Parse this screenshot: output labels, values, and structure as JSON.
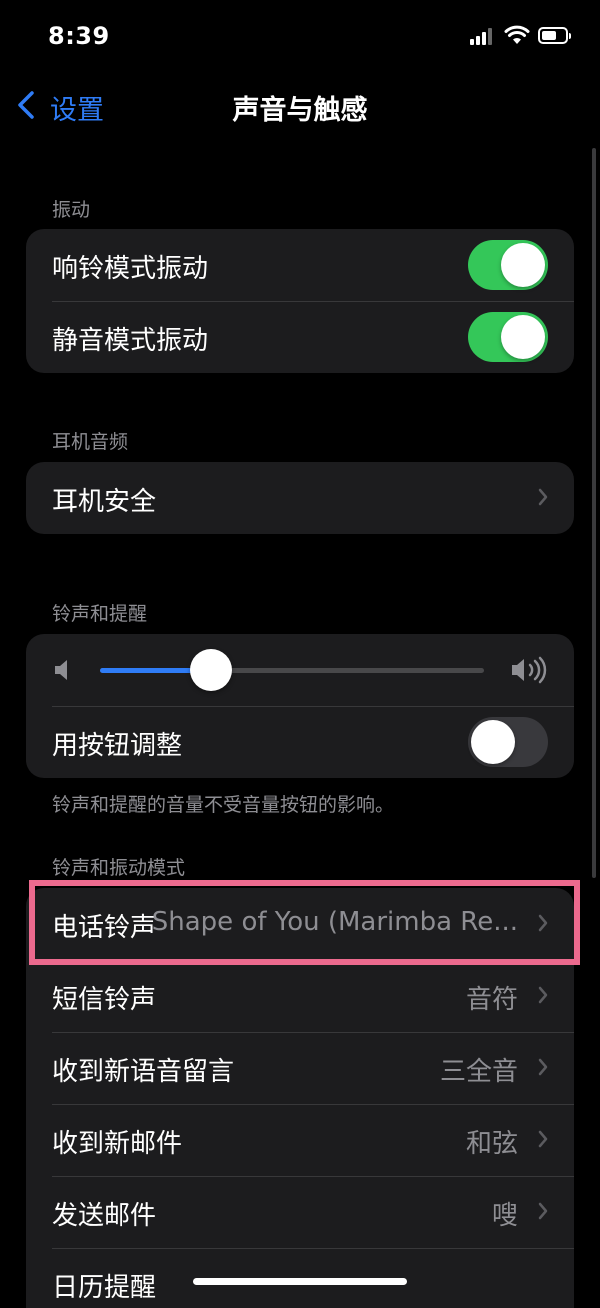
{
  "status": {
    "time": "8:39"
  },
  "nav": {
    "back_label": "设置",
    "title": "声音与触感"
  },
  "sections": {
    "vibration": {
      "header": "振动",
      "rows": [
        {
          "label": "响铃模式振动",
          "toggle": "on"
        },
        {
          "label": "静音模式振动",
          "toggle": "on"
        }
      ]
    },
    "headphone": {
      "header": "耳机音频",
      "rows": [
        {
          "label": "耳机安全"
        }
      ]
    },
    "ringer": {
      "header": "铃声和提醒",
      "volume_level": 0.29,
      "adjust_label": "用按钮调整",
      "adjust_toggle": "off",
      "footer": "铃声和提醒的音量不受音量按钮的影响。"
    },
    "sounds": {
      "header": "铃声和振动模式",
      "rows": [
        {
          "label": "电话铃声",
          "value": "Shape of You (Marimba Re..."
        },
        {
          "label": "短信铃声",
          "value": "音符"
        },
        {
          "label": "收到新语音留言",
          "value": "三全音"
        },
        {
          "label": "收到新邮件",
          "value": "和弦"
        },
        {
          "label": "发送邮件",
          "value": "嗖"
        },
        {
          "label": "日历提醒",
          "value": ""
        }
      ]
    }
  },
  "colors": {
    "accent": "#2f7cf6",
    "toggle_on": "#34c759",
    "highlight": "#ec6a8e"
  }
}
